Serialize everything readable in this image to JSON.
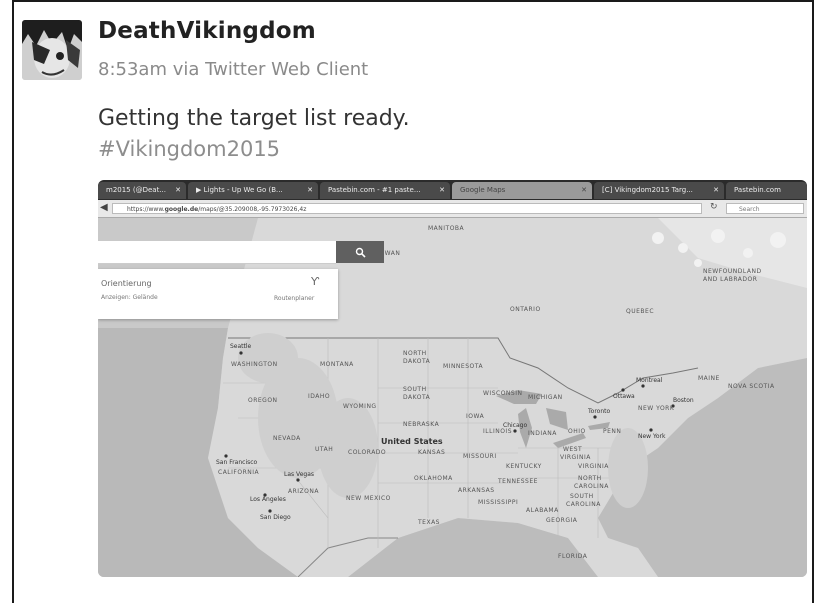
{
  "tweet": {
    "username": "DeathVikingdom",
    "meta": "8:53am via Twitter Web Client",
    "text": "Getting the target list ready.",
    "hashtag": "#Vikingdom2015"
  },
  "browser": {
    "tabs": [
      {
        "label": "m2015 (@Deat...",
        "active": false
      },
      {
        "label": "▶ Lights - Up We Go (B...",
        "active": false
      },
      {
        "label": "Pastebin.com - #1 paste...",
        "active": false
      },
      {
        "label": "Google Maps",
        "active": true
      },
      {
        "label": "[C] Vikingdom2015 Targ...",
        "active": false
      },
      {
        "label": "Pastebin.com",
        "active": false
      }
    ],
    "url_prefix": "https://www.",
    "url_domain": "google.de",
    "url_rest": "/maps/@35.209008,-95.7973026,4z",
    "search_placeholder": "Search"
  },
  "maps_ui": {
    "directions_title": "Orientierung",
    "directions_sub": "Anzeigen: Gelände",
    "route_label": "Routenplaner"
  },
  "map_labels": {
    "countries": [
      "United States"
    ],
    "regions": [
      "MANITOBA",
      "SASKATCHEWAN",
      "ONTARIO",
      "QUEBEC",
      "NEWFOUNDLAND AND LABRADOR",
      "WASHINGTON",
      "MONTANA",
      "NORTH DAKOTA",
      "MINNESOTA",
      "OREGON",
      "IDAHO",
      "SOUTH DAKOTA",
      "WISCONSIN",
      "MICHIGAN",
      "NEW YORK",
      "MAINE",
      "NOVA SCOTIA",
      "WYOMING",
      "NEBRASKA",
      "IOWA",
      "ILLINOIS",
      "INDIANA",
      "OHIO",
      "PENN",
      "NEVADA",
      "UTAH",
      "COLORADO",
      "KANSAS",
      "MISSOURI",
      "WEST VIRGINIA",
      "KENTUCKY",
      "VIRGINIA",
      "CALIFORNIA",
      "ARIZONA",
      "NEW MEXICO",
      "OKLAHOMA",
      "TENNESSEE",
      "NORTH CAROLINA",
      "SOUTH CAROLINA",
      "ARKANSAS",
      "MISSISSIPPI",
      "ALABAMA",
      "GEORGIA",
      "TEXAS",
      "FLORIDA"
    ],
    "cities": [
      "Seattle",
      "San Francisco",
      "Las Vegas",
      "Los Angeles",
      "San Diego",
      "Chicago",
      "Toronto",
      "Montreal",
      "Boston",
      "New York",
      "Ottawa"
    ]
  }
}
